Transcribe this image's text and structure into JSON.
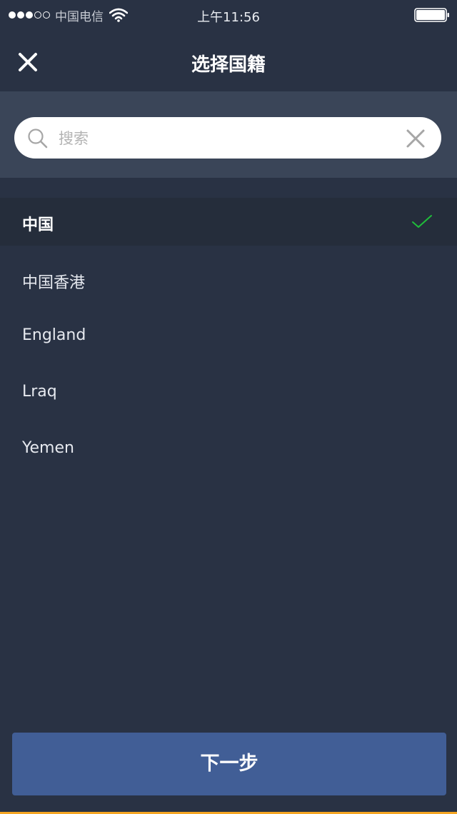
{
  "status_bar": {
    "carrier": "中国电信",
    "time": "上午11:56",
    "signal_bars_filled": 3,
    "signal_bars_total": 5
  },
  "nav": {
    "title": "选择国籍",
    "close_icon": "close-icon"
  },
  "search": {
    "placeholder": "搜索",
    "value": "",
    "search_icon": "search-icon",
    "clear_icon": "clear-icon"
  },
  "countries": [
    {
      "label": "中国",
      "selected": true
    },
    {
      "label": "中国香港",
      "selected": false
    },
    {
      "label": "England",
      "selected": false
    },
    {
      "label": "Lraq",
      "selected": false
    },
    {
      "label": "Yemen",
      "selected": false
    }
  ],
  "next_button": {
    "label": "下一步"
  },
  "colors": {
    "background": "#293244",
    "search_band": "#3a4558",
    "selected_row": "#252d3b",
    "check_green": "#1fbd3a",
    "button": "#415e96"
  }
}
